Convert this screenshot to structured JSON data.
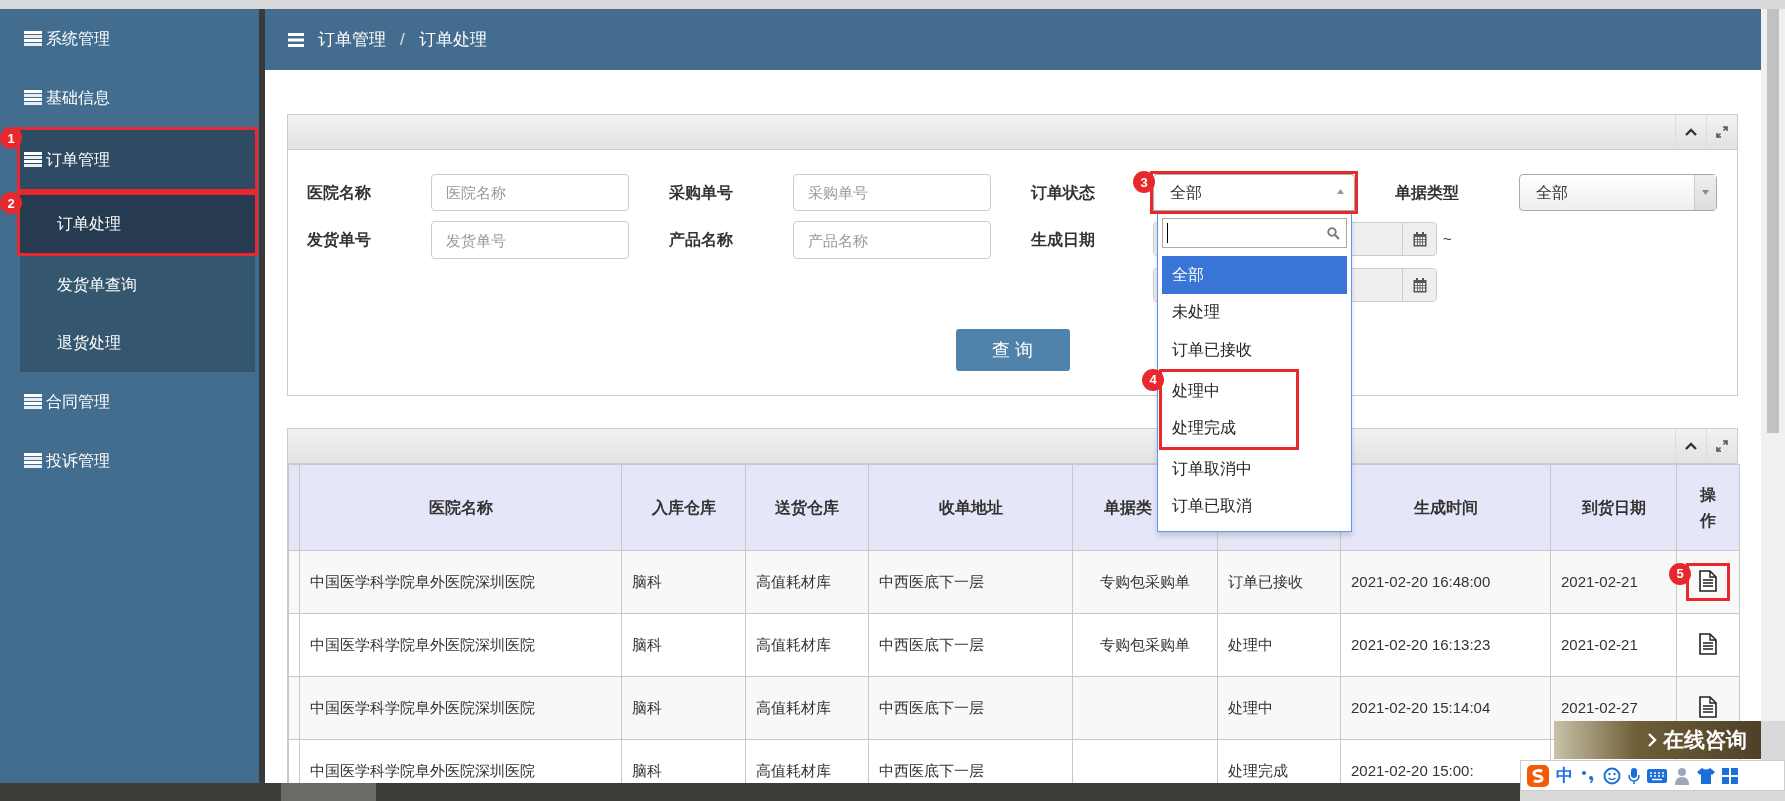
{
  "sidebar": {
    "items": [
      {
        "label": "系统管理",
        "selected": false
      },
      {
        "label": "基础信息",
        "selected": false
      },
      {
        "label": "订单管理",
        "selected": true,
        "annotation": "1",
        "children": [
          {
            "label": "订单处理",
            "selected": true,
            "annotation": "2"
          },
          {
            "label": "发货单查询",
            "selected": false
          },
          {
            "label": "退货处理",
            "selected": false
          }
        ]
      },
      {
        "label": "合同管理",
        "selected": false
      },
      {
        "label": "投诉管理",
        "selected": false
      }
    ]
  },
  "breadcrumb": {
    "items": [
      "订单管理",
      "订单处理"
    ],
    "separator": "/"
  },
  "filter_panel": {
    "fields": [
      {
        "kind": "text",
        "label": "医院名称",
        "placeholder": "医院名称"
      },
      {
        "kind": "text",
        "label": "采购单号",
        "placeholder": "采购单号"
      },
      {
        "kind": "select",
        "label": "订单状态",
        "value": "全部",
        "expanded": true,
        "annotation": "3",
        "options": [
          {
            "kind": "option",
            "label": "全部",
            "selected": true
          },
          {
            "kind": "option",
            "label": "未处理",
            "selected": false
          },
          {
            "kind": "option",
            "label": "订单已接收",
            "selected": false
          },
          {
            "kind": "group",
            "annotation": "4",
            "options": [
              {
                "kind": "option",
                "label": "处理中",
                "selected": false
              },
              {
                "kind": "option",
                "label": "处理完成",
                "selected": false
              }
            ]
          },
          {
            "kind": "option",
            "label": "订单取消中",
            "selected": false
          },
          {
            "kind": "option",
            "label": "订单已取消",
            "selected": false
          }
        ]
      },
      {
        "kind": "select",
        "label": "单据类型",
        "value": "全部",
        "expanded": false
      },
      {
        "kind": "text",
        "label": "发货单号",
        "placeholder": "发货单号"
      },
      {
        "kind": "text",
        "label": "产品名称",
        "placeholder": "产品名称"
      },
      {
        "kind": "date_range",
        "label": "生成日期",
        "separator": "~"
      }
    ],
    "query_button": "查 询"
  },
  "table": {
    "columns": [
      {
        "label": "医院名称"
      },
      {
        "label": "入库仓库"
      },
      {
        "label": "送货仓库"
      },
      {
        "label": "收单地址"
      },
      {
        "label": "单据类"
      },
      {},
      {
        "label": "生成时间"
      },
      {
        "label": "到货日期"
      },
      {
        "label": "操作"
      }
    ],
    "rows": [
      {
        "cells": [
          "中国医学科学院阜外医院深圳医院",
          "脑科",
          "高值耗材库",
          "中西医底下一层",
          "专购包采购单",
          "订单已接收",
          "2021-02-20 16:48:00",
          "2021-02-21"
        ],
        "action_visible": true,
        "annotation": "5"
      },
      {
        "cells": [
          "中国医学科学院阜外医院深圳医院",
          "脑科",
          "高值耗材库",
          "中西医底下一层",
          "专购包采购单",
          "处理中",
          "2021-02-20 16:13:23",
          "2021-02-21"
        ],
        "action_visible": true
      },
      {
        "cells": [
          "中国医学科学院阜外医院深圳医院",
          "脑科",
          "高值耗材库",
          "中西医底下一层",
          "",
          "处理中",
          "2021-02-20 15:14:04",
          "2021-02-27"
        ],
        "action_visible": true
      },
      {
        "cells": [
          "中国医学科学院阜外医院深圳医院",
          "脑科",
          "高值耗材库",
          "中西医底下一层",
          "",
          "处理完成",
          "2021-02-20 15:00:",
          ""
        ],
        "action_visible": false
      }
    ]
  },
  "consult_button": "在线咨询",
  "ime_toolbar": {
    "mode": "中"
  }
}
